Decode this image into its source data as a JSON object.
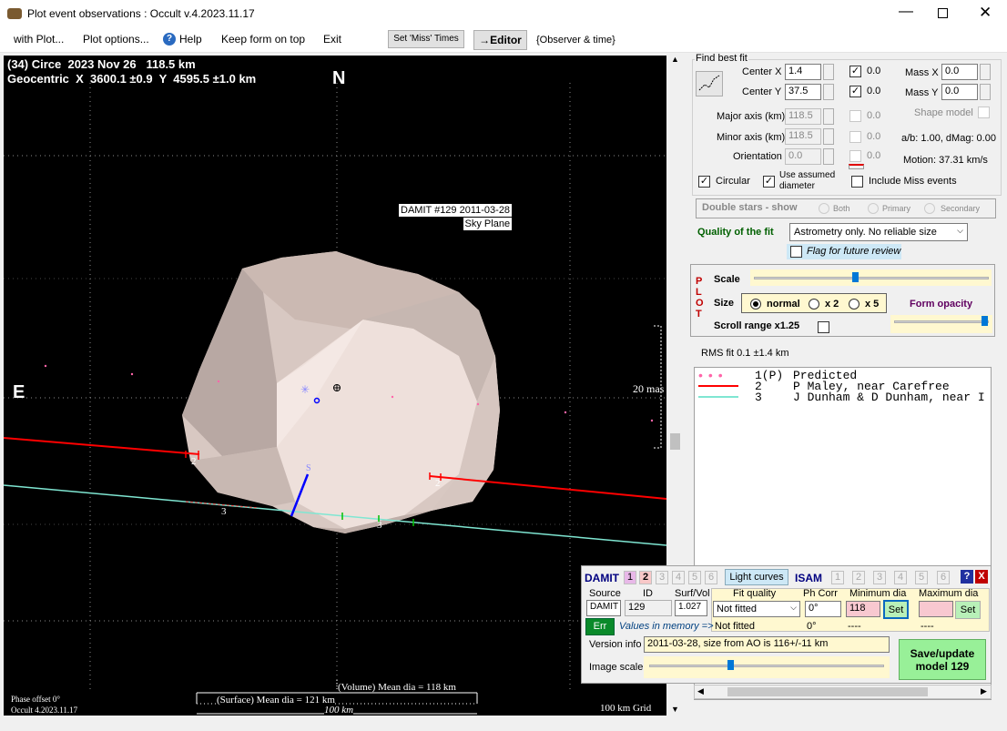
{
  "window": {
    "title": "Plot event observations : Occult v.4.2023.11.17"
  },
  "menu": {
    "items": [
      "with Plot...",
      "Plot options...",
      "Help",
      "Keep form on top",
      "Exit"
    ],
    "set_miss": "Set 'Miss' Times",
    "editor": "→Editor",
    "observer": "{Observer & time}"
  },
  "plot": {
    "title1": "(34) Circe  2023 Nov 26   118.5 km",
    "title2": "Geocentric  X  3600.1 ±0.9  Y  4595.5 ±1.0 km",
    "north": "N",
    "east": "E",
    "model_label1": "DAMIT #129 2011-03-28",
    "model_label2": "Sky Plane",
    "mas": "20 mas",
    "s": "S",
    "chord_labels": [
      "2",
      "2",
      "3",
      "3"
    ],
    "phase": "Phase offset 0°",
    "version": "Occult 4.2023.11.17",
    "vol": "(Volume) Mean dia = 118 km",
    "surf": "(Surface) Mean dia = 121 km",
    "scale": "100 km",
    "grid": "100 km Grid"
  },
  "fit": {
    "header": "Find best fit",
    "center_x_label": "Center X",
    "center_x": "1.4",
    "center_x_check": "0.0",
    "center_y_label": "Center Y",
    "center_y": "37.5",
    "center_y_check": "0.0",
    "mass_x_label": "Mass X",
    "mass_x": "0.0",
    "mass_y_label": "Mass Y",
    "mass_y": "0.0",
    "major_label": "Major axis (km)",
    "major": "118.5",
    "major_check": "0.0",
    "minor_label": "Minor axis (km)",
    "minor": "118.5",
    "minor_check": "0.0",
    "orient_label": "Orientation",
    "orient": "0.0",
    "orient_check": "0.0",
    "shape_model": "Shape model",
    "ab": "a/b: 1.00, dMag: 0.00",
    "motion": "Motion: 37.31 km/s",
    "circular": "Circular",
    "use_assumed": "Use assumed",
    "diameter": "diameter",
    "include_miss": "Include Miss events",
    "double": "Double stars - show",
    "both": "Both",
    "primary": "Primary",
    "secondary": "Secondary",
    "quality_label": "Quality of the fit",
    "quality": "Astrometry only. No reliable size",
    "flag": "Flag for future review"
  },
  "plotbox": {
    "letters": [
      "P",
      "L",
      "O",
      "T"
    ],
    "scale": "Scale",
    "size": "Size",
    "normal": "normal",
    "x2": "x 2",
    "x5": "x 5",
    "form_opacity": "Form opacity",
    "scroll_range": "Scroll range x1.25"
  },
  "rms": "RMS fit 0.1 ±1.4 km",
  "legend": [
    {
      "num": "1(P)",
      "text": "Predicted",
      "color": "#ff66aa"
    },
    {
      "num": "2",
      "text": "P Maley, near Carefree",
      "color": "#ff0000"
    },
    {
      "num": "3",
      "text": "J Dunham & D Dunham, near I",
      "color": "#66e0c0"
    }
  ],
  "damit": {
    "label": "DAMIT",
    "tabs": [
      "1",
      "2",
      "3",
      "4",
      "5",
      "6"
    ],
    "light_curves": "Light curves",
    "isam": "ISAM",
    "isam_tabs": [
      "1",
      "2",
      "3",
      "4",
      "5",
      "6"
    ],
    "help": "?",
    "close": "X",
    "source_h": "Source",
    "id_h": "ID",
    "surf_h": "Surf/Vol",
    "source": "DAMIT",
    "id": "129",
    "surf": "1.027",
    "fitq_h": "Fit quality",
    "phcorr_h": "Ph Corr",
    "mindia_h": "Minimum dia",
    "maxdia_h": "Maximum dia",
    "fitq": "Not fitted",
    "phcorr": "0°",
    "mindia": "118",
    "set": "Set",
    "fitq2": "Not fitted",
    "phcorr2": "0°",
    "dash1": "----",
    "dash2": "----",
    "err": "Err",
    "mem": "Values in memory =>",
    "version_label": "Version info",
    "version": "2011-03-28, size from AO is 116+/-11 km",
    "image_scale": "Image scale",
    "save1": "Save/update",
    "save2": "model 129"
  },
  "colors": {
    "chord2": "#ff0000",
    "chord3": "#7fe6d2",
    "predicted": "#ff66aa",
    "shape": "#e8d8d2"
  }
}
